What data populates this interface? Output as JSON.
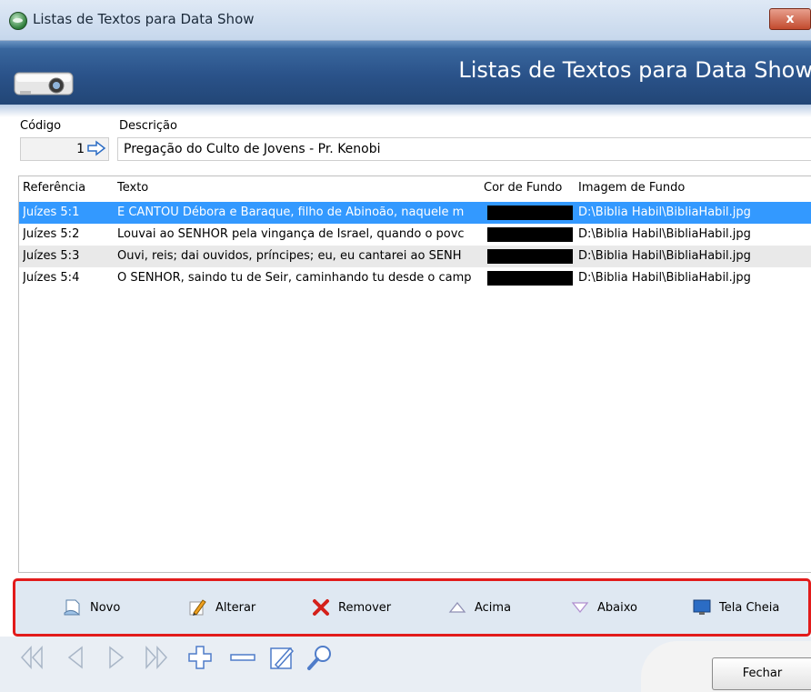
{
  "window": {
    "title": "Listas de Textos para Data Show",
    "close_label": "x"
  },
  "banner": {
    "title": "Listas de Textos para Data Show"
  },
  "form": {
    "codigo_label": "Código",
    "codigo_value": "1",
    "descricao_label": "Descrição",
    "descricao_value": "Pregação do Culto de Jovens - Pr. Kenobi"
  },
  "grid": {
    "columns": [
      "Referência",
      "Texto",
      "Cor de Fundo",
      "Imagem de Fundo"
    ],
    "rows": [
      {
        "ref": "Juízes 5:1",
        "texto": "E CANTOU Débora e Baraque, filho de Abinoão, naquele m",
        "cor": "#000000",
        "imagem": "D:\\Biblia Habil\\BibliaHabil.jpg",
        "selected": true
      },
      {
        "ref": "Juízes 5:2",
        "texto": "Louvai ao SENHOR pela vingança de Israel, quando o povc",
        "cor": "#000000",
        "imagem": "D:\\Biblia Habil\\BibliaHabil.jpg",
        "selected": false
      },
      {
        "ref": "Juízes 5:3",
        "texto": "Ouvi, reis; dai ouvidos, príncipes; eu, eu cantarei ao SENH",
        "cor": "#000000",
        "imagem": "D:\\Biblia Habil\\BibliaHabil.jpg",
        "selected": false
      },
      {
        "ref": "Juízes 5:4",
        "texto": "Ó SENHOR, saindo tu de Seir, caminhando tu desde o camp",
        "cor": "#000000",
        "imagem": "D:\\Biblia Habil\\BibliaHabil.jpg",
        "selected": false
      }
    ]
  },
  "toolbar": {
    "novo": "Novo",
    "alterar": "Alterar",
    "remover": "Remover",
    "acima": "Acima",
    "abaixo": "Abaixo",
    "tela_cheia": "Tela Cheia"
  },
  "footer": {
    "fechar": "Fechar"
  },
  "colors": {
    "selection": "#3399ff",
    "highlight_border": "#e21b1b",
    "banner": "#2a5289"
  },
  "icons": [
    "app-icon",
    "projector-icon",
    "arrow-right-icon",
    "new-document-icon",
    "pencil-icon",
    "delete-x-icon",
    "triangle-up-icon",
    "triangle-down-icon",
    "monitor-icon",
    "first-icon",
    "prior-icon",
    "next-icon",
    "last-icon",
    "add-icon",
    "remove-icon",
    "edit-icon",
    "search-icon"
  ]
}
